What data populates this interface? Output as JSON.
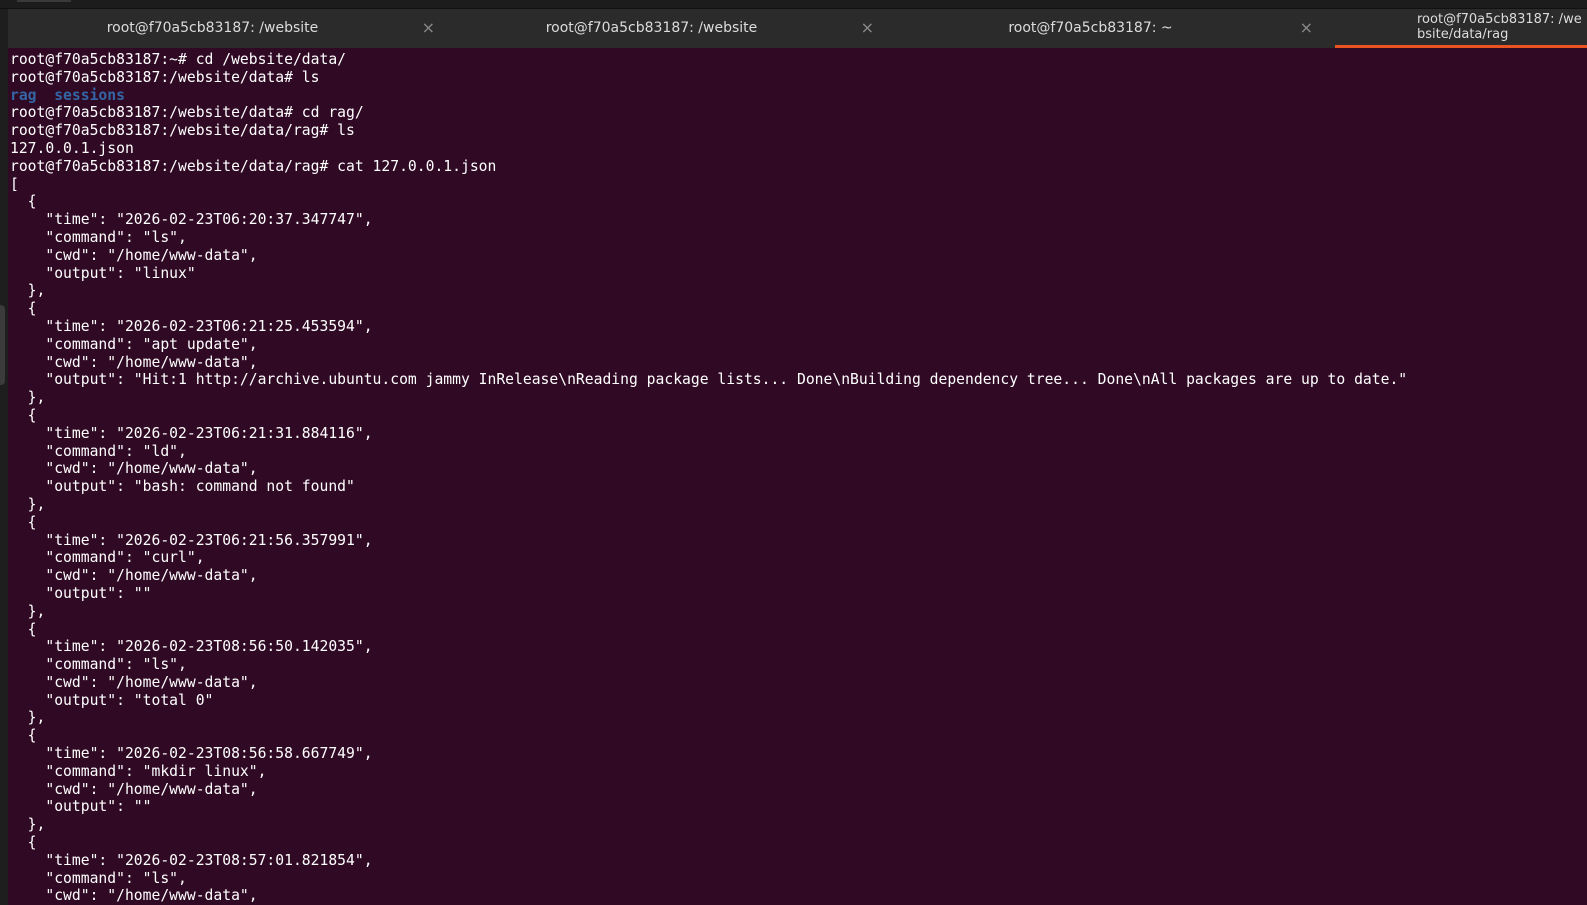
{
  "tabs": [
    {
      "label": "root@f70a5cb83187: /website",
      "close": "×"
    },
    {
      "label": "root@f70a5cb83187: /website",
      "close": "×"
    },
    {
      "label": "root@f70a5cb83187: ~",
      "close": "×"
    },
    {
      "label": "root@f70a5cb83187: /website/data/rag"
    }
  ],
  "accent": "#e95420",
  "terminal": {
    "lines": [
      {
        "text": "root@f70a5cb83187:~# cd /website/data/"
      },
      {
        "text": "root@f70a5cb83187:/website/data# ls"
      },
      {
        "text": "rag  sessions",
        "style": "blue"
      },
      {
        "text": "root@f70a5cb83187:/website/data# cd rag/"
      },
      {
        "text": "root@f70a5cb83187:/website/data/rag# ls"
      },
      {
        "text": "127.0.0.1.json"
      },
      {
        "text": "root@f70a5cb83187:/website/data/rag# cat 127.0.0.1.json"
      },
      {
        "text": "["
      },
      {
        "text": "  {"
      },
      {
        "text": "    \"time\": \"2026-02-23T06:20:37.347747\","
      },
      {
        "text": "    \"command\": \"ls\","
      },
      {
        "text": "    \"cwd\": \"/home/www-data\","
      },
      {
        "text": "    \"output\": \"linux\""
      },
      {
        "text": "  },"
      },
      {
        "text": "  {"
      },
      {
        "text": "    \"time\": \"2026-02-23T06:21:25.453594\","
      },
      {
        "text": "    \"command\": \"apt update\","
      },
      {
        "text": "    \"cwd\": \"/home/www-data\","
      },
      {
        "text": "    \"output\": \"Hit:1 http://archive.ubuntu.com jammy InRelease\\nReading package lists... Done\\nBuilding dependency tree... Done\\nAll packages are up to date.\""
      },
      {
        "text": "  },"
      },
      {
        "text": "  {"
      },
      {
        "text": "    \"time\": \"2026-02-23T06:21:31.884116\","
      },
      {
        "text": "    \"command\": \"ld\","
      },
      {
        "text": "    \"cwd\": \"/home/www-data\","
      },
      {
        "text": "    \"output\": \"bash: command not found\""
      },
      {
        "text": "  },"
      },
      {
        "text": "  {"
      },
      {
        "text": "    \"time\": \"2026-02-23T06:21:56.357991\","
      },
      {
        "text": "    \"command\": \"curl\","
      },
      {
        "text": "    \"cwd\": \"/home/www-data\","
      },
      {
        "text": "    \"output\": \"\""
      },
      {
        "text": "  },"
      },
      {
        "text": "  {"
      },
      {
        "text": "    \"time\": \"2026-02-23T08:56:50.142035\","
      },
      {
        "text": "    \"command\": \"ls\","
      },
      {
        "text": "    \"cwd\": \"/home/www-data\","
      },
      {
        "text": "    \"output\": \"total 0\""
      },
      {
        "text": "  },"
      },
      {
        "text": "  {"
      },
      {
        "text": "    \"time\": \"2026-02-23T08:56:58.667749\","
      },
      {
        "text": "    \"command\": \"mkdir linux\","
      },
      {
        "text": "    \"cwd\": \"/home/www-data\","
      },
      {
        "text": "    \"output\": \"\""
      },
      {
        "text": "  },"
      },
      {
        "text": "  {"
      },
      {
        "text": "    \"time\": \"2026-02-23T08:57:01.821854\","
      },
      {
        "text": "    \"command\": \"ls\","
      },
      {
        "text": "    \"cwd\": \"/home/www-data\","
      }
    ]
  }
}
